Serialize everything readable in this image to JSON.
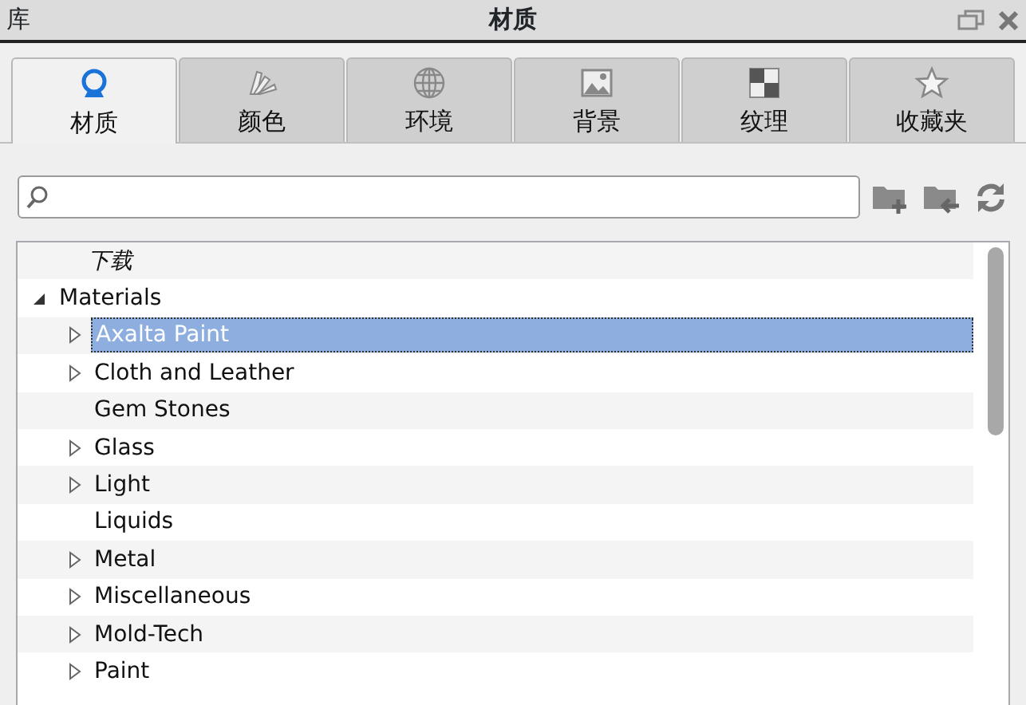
{
  "panel": {
    "left_label": "库",
    "title": "材质"
  },
  "tabs": [
    {
      "label": "材质",
      "selected": true
    },
    {
      "label": "颜色",
      "selected": false
    },
    {
      "label": "环境",
      "selected": false
    },
    {
      "label": "背景",
      "selected": false
    },
    {
      "label": "纹理",
      "selected": false
    },
    {
      "label": "收藏夹",
      "selected": false
    }
  ],
  "tree": [
    {
      "label": "下载",
      "kind": "leaf",
      "italic": true,
      "selected": false
    },
    {
      "label": "Materials",
      "kind": "group",
      "expanded": true,
      "selected": false,
      "children": [
        {
          "label": "Axalta Paint",
          "kind": "group",
          "expanded": false,
          "selected": true
        },
        {
          "label": "Cloth and Leather",
          "kind": "group",
          "expanded": false,
          "selected": false
        },
        {
          "label": "Gem Stones",
          "kind": "leaf",
          "selected": false
        },
        {
          "label": "Glass",
          "kind": "group",
          "expanded": false,
          "selected": false
        },
        {
          "label": "Light",
          "kind": "group",
          "expanded": false,
          "selected": false
        },
        {
          "label": "Liquids",
          "kind": "leaf",
          "selected": false
        },
        {
          "label": "Metal",
          "kind": "group",
          "expanded": false,
          "selected": false
        },
        {
          "label": "Miscellaneous",
          "kind": "group",
          "expanded": false,
          "selected": false
        },
        {
          "label": "Mold-Tech",
          "kind": "group",
          "expanded": false,
          "selected": false
        },
        {
          "label": "Paint",
          "kind": "group",
          "expanded": false,
          "selected": false
        }
      ]
    }
  ]
}
